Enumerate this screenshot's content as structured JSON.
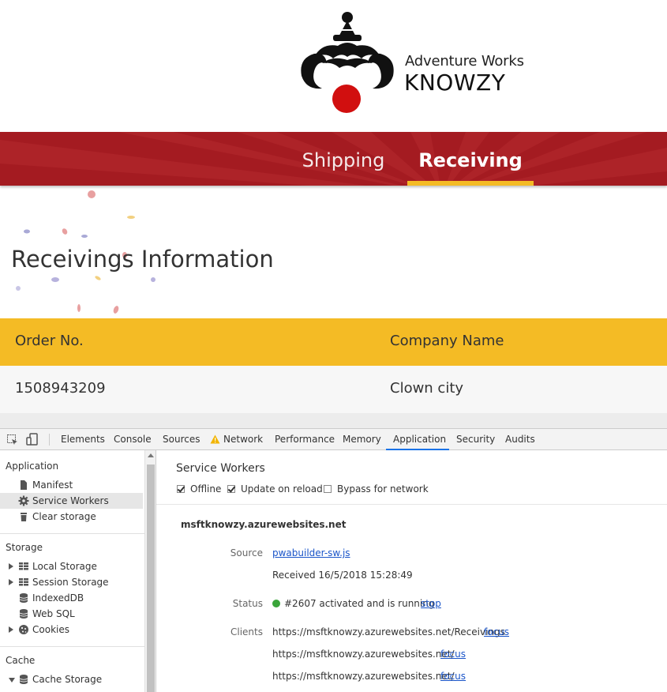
{
  "brand": {
    "line1": "Adventure Works",
    "line2": "KNOWZY",
    "colors": {
      "nav": "#a41b21",
      "accent": "#f4bb25",
      "nose": "#d10f0f"
    }
  },
  "nav": {
    "items": [
      {
        "label": "Shipping",
        "active": false
      },
      {
        "label": "Receiving",
        "active": true
      }
    ]
  },
  "page": {
    "title": "Receivings Information"
  },
  "table": {
    "headers": [
      "Order No.",
      "Company Name"
    ],
    "rows": [
      [
        "1508943209",
        "Clown city"
      ]
    ]
  },
  "devtools": {
    "tabs": [
      "Elements",
      "Console",
      "Sources",
      "Network",
      "Performance",
      "Memory",
      "Application",
      "Security",
      "Audits"
    ],
    "active_tab": "Application",
    "sidebar": {
      "application": {
        "title": "Application",
        "items": [
          "Manifest",
          "Service Workers",
          "Clear storage"
        ]
      },
      "storage": {
        "title": "Storage",
        "items": [
          "Local Storage",
          "Session Storage",
          "IndexedDB",
          "Web SQL",
          "Cookies"
        ]
      },
      "cache": {
        "title": "Cache",
        "items": [
          "Cache Storage"
        ]
      }
    },
    "service_workers": {
      "title": "Service Workers",
      "options": [
        {
          "label": "Offline",
          "checked": true
        },
        {
          "label": "Update on reload",
          "checked": true
        },
        {
          "label": "Bypass for network",
          "checked": false
        }
      ],
      "origin": "msftknowzy.azurewebsites.net",
      "source_label": "Source",
      "source_file": "pwabuilder-sw.js",
      "received": "Received 16/5/2018 15:28:49",
      "status_label": "Status",
      "status_text": "#2607 activated and is running",
      "stop_label": "stop",
      "clients_label": "Clients",
      "clients": [
        {
          "url": "https://msftknowzy.azurewebsites.net/Receivings",
          "action": "focus"
        },
        {
          "url": "https://msftknowzy.azurewebsites.net/",
          "action": "focus"
        },
        {
          "url": "https://msftknowzy.azurewebsites.net/",
          "action": "focus"
        }
      ]
    }
  }
}
